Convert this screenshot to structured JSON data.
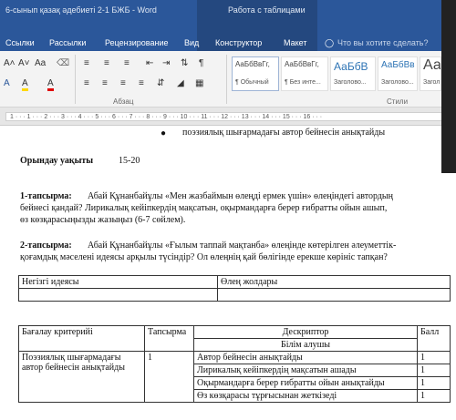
{
  "window": {
    "doc_title": "6-сынып қазақ әдебиеті 2-1 БЖБ - Word",
    "context_title": "Работа с таблицами"
  },
  "tabs": [
    "Ссылки",
    "Рассылки",
    "Рецензирование",
    "Вид",
    "Конструктор",
    "Макет"
  ],
  "tell_me": "Что вы хотите сделать?",
  "ribbon": {
    "font_size_up": "A˄",
    "font_size_down": "A˅",
    "case": "Aa",
    "highlight": "A",
    "paragraph_mark": "¶",
    "group_paragraph": "Абзац",
    "group_styles": "Стили",
    "styles": [
      {
        "sample": "АаБбВвГг,",
        "name": "¶ Обычный"
      },
      {
        "sample": "АаБбВвГг,",
        "name": "¶ Без инте..."
      },
      {
        "sample": "АаБбВ",
        "name": "Заголово..."
      },
      {
        "sample": "АаБбВв",
        "name": "Заголово..."
      },
      {
        "sample": "Аа",
        "name": "Загол"
      }
    ]
  },
  "ruler_text": "1 · · · 1 · · · 2 · · · 3 · · · 4 · · · 5 · · · 6 · · · 7 · · · 8 · · · 9 · · · 10 · · · 11 · · · 12 · · · 13 · · · 14 · · · 15 · · · 16 · · ·",
  "document": {
    "bullet": "поэзиялық шығармадағы автор бейнесін анықтайды",
    "time_label": "Орындау уақыты",
    "time_value": "15-20",
    "task1_label": "1-тапсырма:",
    "task1_line1": "Абай Құнанбайұлы «Мен жазбаймын өлеңді ермек үшін» өлеңіндегі автордың",
    "task1_line2": "бейнесі қандай? Лирикалық кейіпкердің мақсатын, оқырмандарға берер ғибратты ойын ашып,",
    "task1_line3": "өз көзқарасыңызды жазыңыз (6-7 сөйлем).",
    "task2_label": "2-тапсырма:",
    "task2_line1": "Абай Құнанбайұлы «Ғылым таппай мақтанба» өлеңінде көтерілген әлеуметтік-",
    "task2_line2": "қоғамдық мәселені идеясы арқылы түсіндір? Ол өлеңнің қай бөлігінде ерекше көрініс тапқан?",
    "table1": {
      "col1": "Негізгі идеясы",
      "col2": "Өлең жолдары"
    },
    "table2": {
      "h_criterion": "Бағалау критерийі",
      "h_task": "Тапсырма",
      "h_descriptor": "Дескриптор",
      "h_score": "Балл",
      "sub_header": "Білім алушы",
      "criterion": "Поэзиялық шығармадағы автор бейнесін анықтайды",
      "task_no": "1",
      "rows": [
        {
          "descriptor": "Автор бейнесін анықтайды",
          "score": "1"
        },
        {
          "descriptor": "Лирикалық кейіпкердің мақсатын ашады",
          "score": "1"
        },
        {
          "descriptor": "Оқырмандарға берер ғибратты ойын анықтайды",
          "score": "1"
        },
        {
          "descriptor": "Өз көзқарасы тұрғысынан жеткізеді",
          "score": "1"
        }
      ]
    }
  }
}
